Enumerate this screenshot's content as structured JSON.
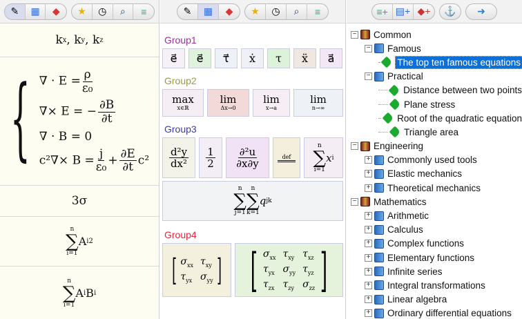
{
  "toolbar_left": {
    "icons": [
      "edit-icon",
      "palette-icon",
      "bookmark-icon",
      "favorites-icon",
      "history-icon",
      "search-icon",
      "library-icon"
    ]
  },
  "toolbar_right": {
    "icons": [
      "add-library-icon",
      "add-notebook-icon",
      "add-bookmark-icon",
      "anchor-icon",
      "forward-arrow-icon"
    ]
  },
  "history": {
    "k": "kₓ, k_y, k_z",
    "k_parts": [
      "k",
      "x",
      ", k",
      "y",
      ", k",
      "z"
    ],
    "maxwell": [
      {
        "lhs": "∇ · E =",
        "num": "ρ",
        "den": "ε₀"
      },
      {
        "lhs": "∇× E = −",
        "num": "∂B",
        "den": "∂t"
      },
      {
        "lhs": "∇ · B = 0"
      },
      {
        "lhs": "c²∇× B =",
        "num": "j",
        "den": "ε₀",
        "plus": "+",
        "num2": "∂E",
        "den2": "∂t",
        "tail": "c²"
      }
    ],
    "sigma": "3σ",
    "sum1": {
      "top": "n",
      "bottom": "i=1",
      "body": "A",
      "sub": "i",
      "sup": "2"
    },
    "sum2": {
      "top": "n",
      "bottom": "i=1",
      "body": "A",
      "sub": "i",
      "body2": "B",
      "sub2": "i"
    }
  },
  "groups": [
    {
      "title": "Group1",
      "color": "#9b2f9b",
      "tiles": [
        "e⃗",
        "e⃗",
        "τ⃗",
        "ẋ",
        "τ",
        "ẍ",
        "a⃗"
      ]
    },
    {
      "title": "Group2",
      "color": "#9a9a3a",
      "tiles": [
        {
          "op": "max",
          "sub": "x∈ℝ"
        },
        {
          "op": "lim",
          "sub": "Δx→0"
        },
        {
          "op": "lim",
          "sub": "x→a"
        },
        {
          "op": "lim",
          "sub": "n→∞"
        }
      ]
    },
    {
      "title": "Group3",
      "color": "#3a3aa8",
      "tiles": {
        "d2": {
          "num": "d²y",
          "den": "dx²"
        },
        "half": {
          "num": "1",
          "den": "2"
        },
        "partial": {
          "num": "∂²u",
          "den": "∂x∂y"
        },
        "def": "def",
        "sumx": {
          "top": "n",
          "bottom": "i=1",
          "body": "x",
          "sub": "i"
        },
        "dsum": {
          "top1": "n",
          "bottom1": "j=1",
          "top2": "n",
          "bottom2": "k=1",
          "body": "q",
          "sub": "jk"
        }
      }
    },
    {
      "title": "Group4",
      "color": "#e0263a",
      "tiles": {
        "m2": [
          [
            "σ",
            "xx",
            "τ",
            "xy"
          ],
          [
            "τ",
            "yx",
            "σ",
            "yy"
          ]
        ],
        "m3": [
          [
            "σ",
            "xx",
            "τ",
            "xy",
            "τ",
            "xz"
          ],
          [
            "τ",
            "yx",
            "σ",
            "yy",
            "τ",
            "yz"
          ],
          [
            "τ",
            "zx",
            "τ",
            "zy",
            "σ",
            "zz"
          ]
        ]
      }
    }
  ],
  "tree": [
    {
      "label": "Common",
      "level": 0,
      "type": "category",
      "exp": "−"
    },
    {
      "label": "Famous",
      "level": 1,
      "type": "book",
      "exp": "−"
    },
    {
      "label": "The top ten famous equations",
      "level": 2,
      "type": "pin",
      "selected": true
    },
    {
      "label": "Practical",
      "level": 1,
      "type": "book",
      "exp": "−"
    },
    {
      "label": "Distance between two points",
      "level": 2,
      "type": "pin"
    },
    {
      "label": "Plane stress",
      "level": 2,
      "type": "pin"
    },
    {
      "label": "Root of the quadratic equation",
      "level": 2,
      "type": "pin"
    },
    {
      "label": "Triangle area",
      "level": 2,
      "type": "pin"
    },
    {
      "label": "Engineering",
      "level": 0,
      "type": "category",
      "exp": "−"
    },
    {
      "label": "Commonly used tools",
      "level": 1,
      "type": "book",
      "exp": "+"
    },
    {
      "label": "Elastic mechanics",
      "level": 1,
      "type": "book",
      "exp": "+"
    },
    {
      "label": "Theoretical mechanics",
      "level": 1,
      "type": "book",
      "exp": "+"
    },
    {
      "label": "Mathematics",
      "level": 0,
      "type": "category",
      "exp": "−"
    },
    {
      "label": "Arithmetic",
      "level": 1,
      "type": "book",
      "exp": "+"
    },
    {
      "label": "Calculus",
      "level": 1,
      "type": "book",
      "exp": "+"
    },
    {
      "label": "Complex functions",
      "level": 1,
      "type": "book",
      "exp": "+"
    },
    {
      "label": "Elementary functions",
      "level": 1,
      "type": "book",
      "exp": "+"
    },
    {
      "label": "Infinite series",
      "level": 1,
      "type": "book",
      "exp": "+"
    },
    {
      "label": "Integral transformations",
      "level": 1,
      "type": "book",
      "exp": "+"
    },
    {
      "label": "Linear algebra",
      "level": 1,
      "type": "book",
      "exp": "+"
    },
    {
      "label": "Ordinary differential equations",
      "level": 1,
      "type": "book",
      "exp": "+"
    }
  ]
}
